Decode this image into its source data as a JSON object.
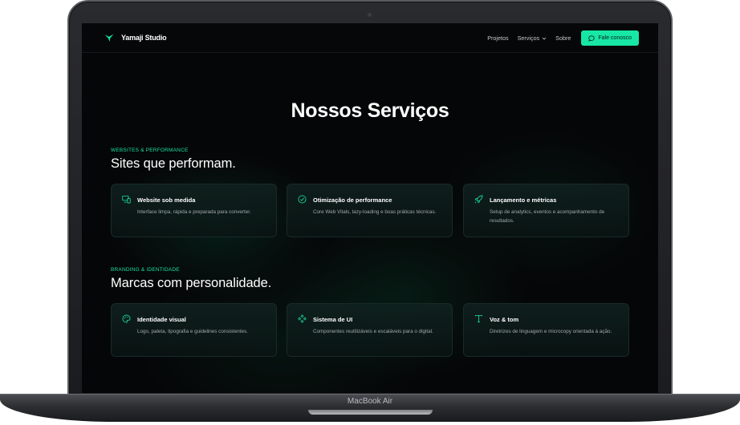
{
  "device": {
    "label": "MacBook Air"
  },
  "nav": {
    "brand": "Yamaji Studio",
    "links": [
      "Projetos",
      "Serviços",
      "Sobre"
    ],
    "cta": "Fale conosco"
  },
  "page": {
    "title": "Nossos Serviços"
  },
  "sections": [
    {
      "eyebrow": "WEBSITES & PERFORMANCE",
      "heading": "Sites que performam.",
      "cards": [
        {
          "icon": "monitor-phone-icon",
          "title": "Website sob medida",
          "desc": "Interface limpa, rápida e preparada para converter."
        },
        {
          "icon": "gauge-check-icon",
          "title": "Otimização de performance",
          "desc": "Core Web Vitals, lazy-loading e boas práticas técnicas."
        },
        {
          "icon": "rocket-icon",
          "title": "Lançamento e métricas",
          "desc": "Setup de analytics, eventos e acompanhamento de resultados."
        }
      ]
    },
    {
      "eyebrow": "BRANDING & IDENTIDADE",
      "heading": "Marcas com personalidade.",
      "cards": [
        {
          "icon": "palette-icon",
          "title": "Identidade visual",
          "desc": "Logo, paleta, tipografia e guidelines consistentes."
        },
        {
          "icon": "component-icon",
          "title": "Sistema de UI",
          "desc": "Componentes reutilizáveis e escaláveis para o digital."
        },
        {
          "icon": "type-icon",
          "title": "Voz & tom",
          "desc": "Diretrizes de linguagem e microcopy orientada à ação."
        }
      ]
    }
  ],
  "colors": {
    "accent": "#17e6a4",
    "background": "#050607",
    "card_border": "#1a2a27"
  }
}
